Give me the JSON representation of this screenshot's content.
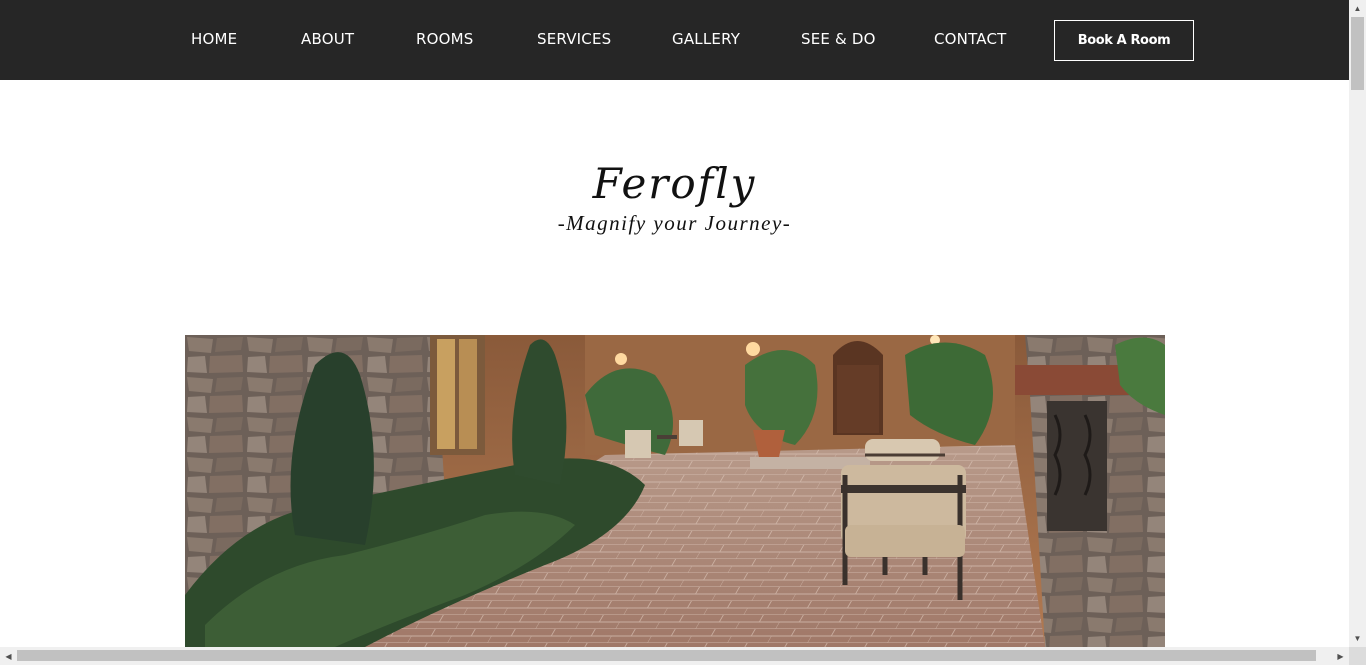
{
  "nav": {
    "items": [
      {
        "label": "HOME"
      },
      {
        "label": "ABOUT"
      },
      {
        "label": "ROOMS"
      },
      {
        "label": "SERVICES"
      },
      {
        "label": "GALLERY"
      },
      {
        "label": "SEE & DO"
      },
      {
        "label": "CONTACT"
      }
    ],
    "book_label": "Book A Room"
  },
  "brand": {
    "title": "Ferofly",
    "tagline": "-Magnify your Journey-"
  },
  "colors": {
    "nav_background": "#262626",
    "nav_text": "#ffffff",
    "page_background": "#ffffff"
  },
  "hero": {
    "icon": "courtyard-photo"
  }
}
